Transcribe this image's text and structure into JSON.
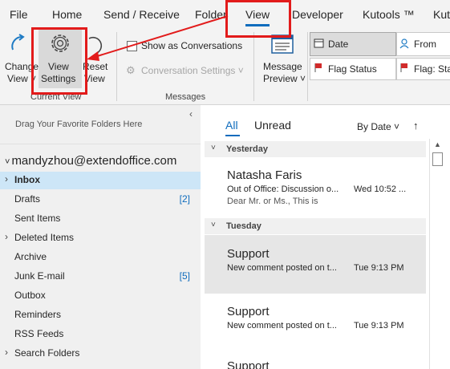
{
  "ribbon_tabs": [
    "File",
    "Home",
    "Send / Receive",
    "Folder",
    "View",
    "Developer",
    "Kutools ™",
    "Kuto"
  ],
  "active_tab": "View",
  "ribbon": {
    "change_view": [
      "Change",
      "View ˅"
    ],
    "view_settings": [
      "View",
      "Settings"
    ],
    "reset_view": [
      "Reset",
      "View"
    ],
    "current_view_group": "Current View",
    "show_as_conversations": "Show as Conversations",
    "conversation_settings": "Conversation Settings ˅",
    "messages_group": "Messages",
    "message_preview": [
      "Message",
      "Preview ˅"
    ],
    "arrangement": [
      "Date",
      "From",
      "Flag Status",
      "Flag: Sta"
    ]
  },
  "folder_pane": {
    "drag_hint": "Drag Your Favorite Folders Here",
    "account": "mandyzhou@extendoffice.com",
    "folders": [
      {
        "name": "Inbox",
        "count": "",
        "expand": "›",
        "selected": true
      },
      {
        "name": "Drafts",
        "count": "[2]",
        "expand": ""
      },
      {
        "name": "Sent Items",
        "count": "",
        "expand": ""
      },
      {
        "name": "Deleted Items",
        "count": "",
        "expand": "›"
      },
      {
        "name": "Archive",
        "count": "",
        "expand": ""
      },
      {
        "name": "Junk E-mail",
        "count": "[5]",
        "expand": ""
      },
      {
        "name": "Outbox",
        "count": "",
        "expand": ""
      },
      {
        "name": "Reminders",
        "count": "",
        "expand": ""
      },
      {
        "name": "RSS Feeds",
        "count": "",
        "expand": ""
      },
      {
        "name": "Search Folders",
        "count": "",
        "expand": "›"
      }
    ]
  },
  "message_list": {
    "filter_all": "All",
    "filter_unread": "Unread",
    "sort_by": "By Date ˅",
    "sort_direction": "↑",
    "groups": [
      {
        "label": "Yesterday"
      },
      {
        "label": "Tuesday"
      }
    ],
    "messages": [
      {
        "sender": "Natasha Faris",
        "subject": "Out of Office: Discussion o...",
        "date": "Wed 10:52 ...",
        "preview": "Dear Mr. or Ms.,   This is"
      },
      {
        "sender": "Support",
        "subject": "New comment posted on t...",
        "date": "Tue 9:13 PM",
        "preview": ""
      },
      {
        "sender": "Support",
        "subject": "New comment posted on t...",
        "date": "Tue 9:13 PM",
        "preview": ""
      },
      {
        "sender": "Support",
        "subject": "",
        "date": "",
        "preview": ""
      }
    ]
  },
  "colors": {
    "accent": "#0f6cbd",
    "annotation_red": "#e21b1b",
    "selected_folder": "#cde6f7"
  }
}
